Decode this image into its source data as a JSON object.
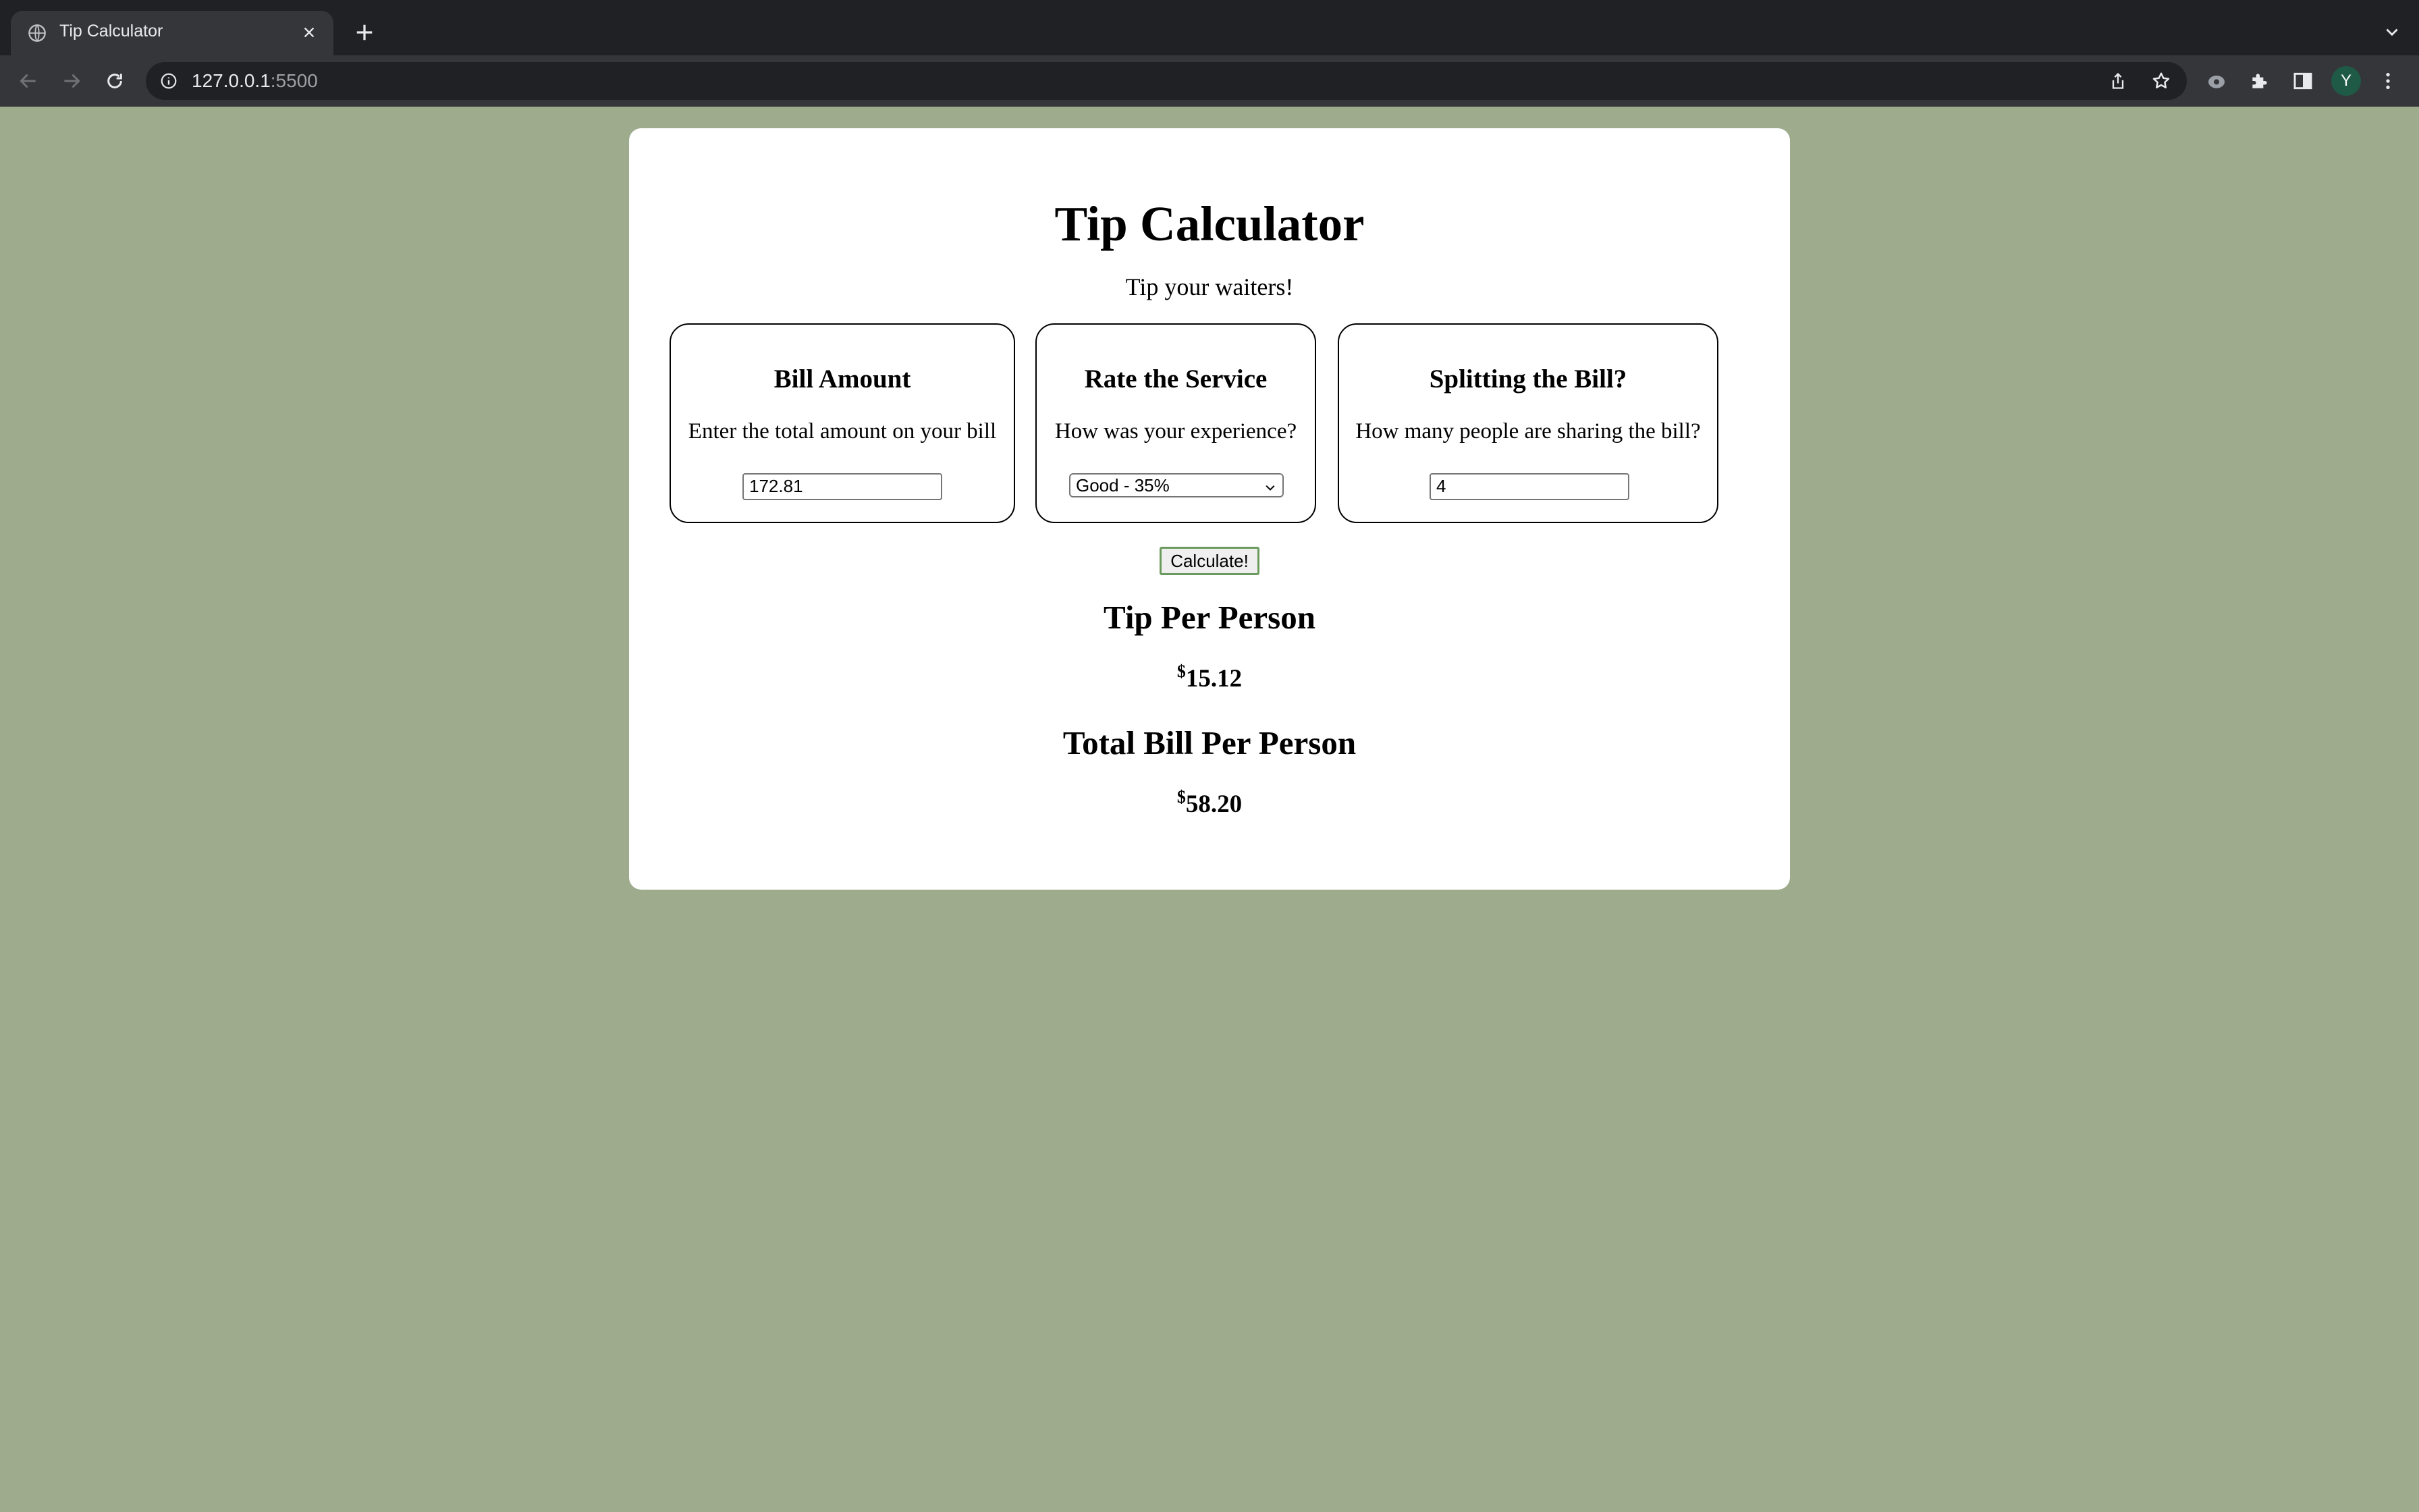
{
  "browser": {
    "tab_title": "Tip Calculator",
    "url_host": "127.0.0.1",
    "url_port": ":5500",
    "profile_initial": "Y"
  },
  "page": {
    "title": "Tip Calculator",
    "subtitle": "Tip your waiters!",
    "bill_box": {
      "heading": "Bill Amount",
      "description": "Enter the total amount on your bill",
      "value": "172.81"
    },
    "service_box": {
      "heading": "Rate the Service",
      "description": "How was your experience?",
      "selected_option": "Good - 35%"
    },
    "split_box": {
      "heading": "Splitting the Bill?",
      "description": "How many people are sharing the bill?",
      "value": "4"
    },
    "calculate_label": "Calculate!",
    "tip_label": "Tip Per Person",
    "tip_currency": "$",
    "tip_value": "15.12",
    "total_label": "Total Bill Per Person",
    "total_currency": "$",
    "total_value": "58.20"
  },
  "colors": {
    "page_background": "#9eac8d",
    "card_background": "#ffffff",
    "button_border": "#6b9a5e"
  },
  "icons": {
    "tab_favicon": "globe-icon",
    "tab_close": "close-icon",
    "new_tab": "plus-icon",
    "back": "back-arrow-icon",
    "forward": "forward-arrow-icon",
    "reload": "reload-icon",
    "site_info": "info-icon",
    "share": "share-icon",
    "bookmark": "star-icon",
    "extension_1": "extension-icon",
    "extensions": "puzzle-icon",
    "side_panel": "side-panel-icon",
    "menu": "kebab-menu-icon"
  }
}
